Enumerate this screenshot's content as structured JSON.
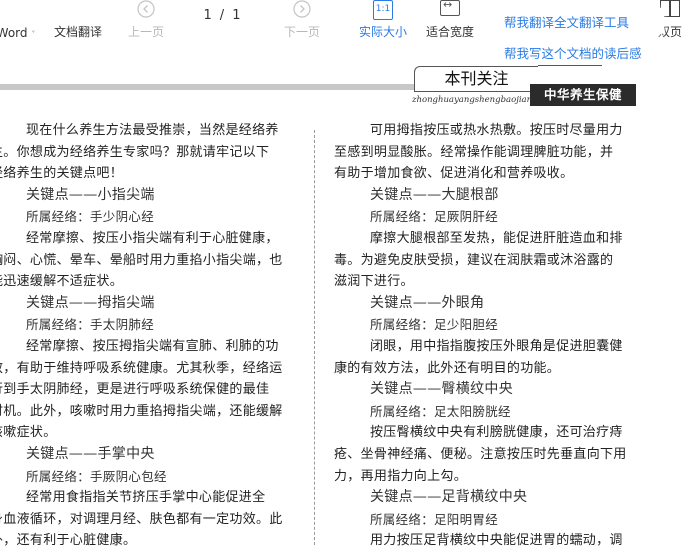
{
  "toolbar": {
    "word_label": "Word",
    "translate_label": "文档翻译",
    "prev_label": "上一页",
    "page_current": "1",
    "page_sep": "/",
    "page_total": "1",
    "next_label": "下一页",
    "actual_size_icon_text": "1:1",
    "actual_size_label": "实际大小",
    "fit_width_label": "适合宽度",
    "dual_page_label": "双页"
  },
  "tips": {
    "translate_all": "帮我翻译全文翻译工具",
    "write_review": "帮我写这个文档的读后感"
  },
  "doc": {
    "column_badge": "本刊关注",
    "pinyin": "zhonghuayangshengbaojian",
    "journal_name": "中华养生保健",
    "left_column": [
      {
        "cls": "body ind1",
        "text": "现在什么养生方法最受推崇，当然是经络养"
      },
      {
        "cls": "body ind0",
        "text": "生。你想成为经络养生专家吗？那就请牢记以下"
      },
      {
        "cls": "body ind0",
        "text": "经络养生的关键点吧！"
      },
      {
        "cls": "heading hd-ind",
        "text": "关键点——小指尖端"
      },
      {
        "cls": "meridian ind-m",
        "text": "所属经络：手少阴心经"
      },
      {
        "cls": "body ind2",
        "text": "经常摩擦、按压小指尖端有利于心脏健康，"
      },
      {
        "cls": "body ind0",
        "text": "胸闷、心慌、晕车、晕船时用力重掐小指尖端，也"
      },
      {
        "cls": "body ind0",
        "text": "能迅速缓解不适症状。"
      },
      {
        "cls": "heading hd-ind",
        "text": "关键点——拇指尖端"
      },
      {
        "cls": "meridian ind-m",
        "text": "所属经络：手太阴肺经"
      },
      {
        "cls": "body ind2",
        "text": "经常摩擦、按压拇指尖端有宣肺、利肺的功"
      },
      {
        "cls": "body ind0",
        "text": "效，有助于维持呼吸系统健康。尤其秋季，经络运"
      },
      {
        "cls": "body ind0",
        "text": "行到手太阴肺经，更是进行呼吸系统保健的最佳"
      },
      {
        "cls": "body ind0",
        "text": "时机。此外，咳嗽时用力重掐拇指尖端，还能缓解"
      },
      {
        "cls": "body ind0",
        "text": "咳嗽症状。"
      },
      {
        "cls": "heading hd-ind",
        "text": "关键点——手掌中央"
      },
      {
        "cls": "meridian ind-m",
        "text": "所属经络：手厥阴心包经"
      },
      {
        "cls": "body ind2",
        "text": "经常用食指指关节挤压手掌中心能促进全"
      },
      {
        "cls": "body ind0",
        "text": "身血液循环，对调理月经、肤色都有一定功效。此"
      },
      {
        "cls": "body ind0",
        "text": "外，还有利于心脏健康。"
      }
    ],
    "right_column": [
      {
        "cls": "body ind1",
        "text": "可用拇指按压或热水热敷。按压时尽量用力"
      },
      {
        "cls": "body ind0",
        "text": "至感到明显酸胀。经常操作能调理脾脏功能，并"
      },
      {
        "cls": "body ind0",
        "text": "有助于增加食欲、促进消化和营养吸收。"
      },
      {
        "cls": "heading hd-ind",
        "text": "关键点——大腿根部"
      },
      {
        "cls": "meridian ind-m",
        "text": "所属经络：足厥阴肝经"
      },
      {
        "cls": "body ind2",
        "text": "摩擦大腿根部至发热，能促进肝脏造血和排"
      },
      {
        "cls": "body ind0",
        "text": "毒。为避免皮肤受损，建议在润肤霜或沐浴露的"
      },
      {
        "cls": "body ind0",
        "text": "滋润下进行。"
      },
      {
        "cls": "heading hd-ind",
        "text": "关键点——外眼角"
      },
      {
        "cls": "meridian ind-m",
        "text": "所属经络：足少阳胆经"
      },
      {
        "cls": "body ind2",
        "text": "闭眼，用中指指腹按压外眼角是促进胆囊健"
      },
      {
        "cls": "body ind0",
        "text": "康的有效方法，此外还有明目的功能。"
      },
      {
        "cls": "heading hd-ind",
        "text": "关键点——臀横纹中央"
      },
      {
        "cls": "meridian ind-m",
        "text": "所属经络：足太阳膀胱经"
      },
      {
        "cls": "body ind2",
        "text": "按压臀横纹中央有利膀胱健康，还可治疗痔"
      },
      {
        "cls": "body ind0",
        "text": "疮、坐骨神经痛、便秘。注意按压时先垂直向下用"
      },
      {
        "cls": "body ind0",
        "text": "力，再用指力向上勾。"
      },
      {
        "cls": "heading hd-ind",
        "text": "关键点——足背横纹中央"
      },
      {
        "cls": "meridian ind-m",
        "text": "所属经络：足阳明胃经"
      },
      {
        "cls": "body ind2",
        "text": "用力按压足背横纹中央能促进胃的蠕动，调"
      }
    ]
  }
}
